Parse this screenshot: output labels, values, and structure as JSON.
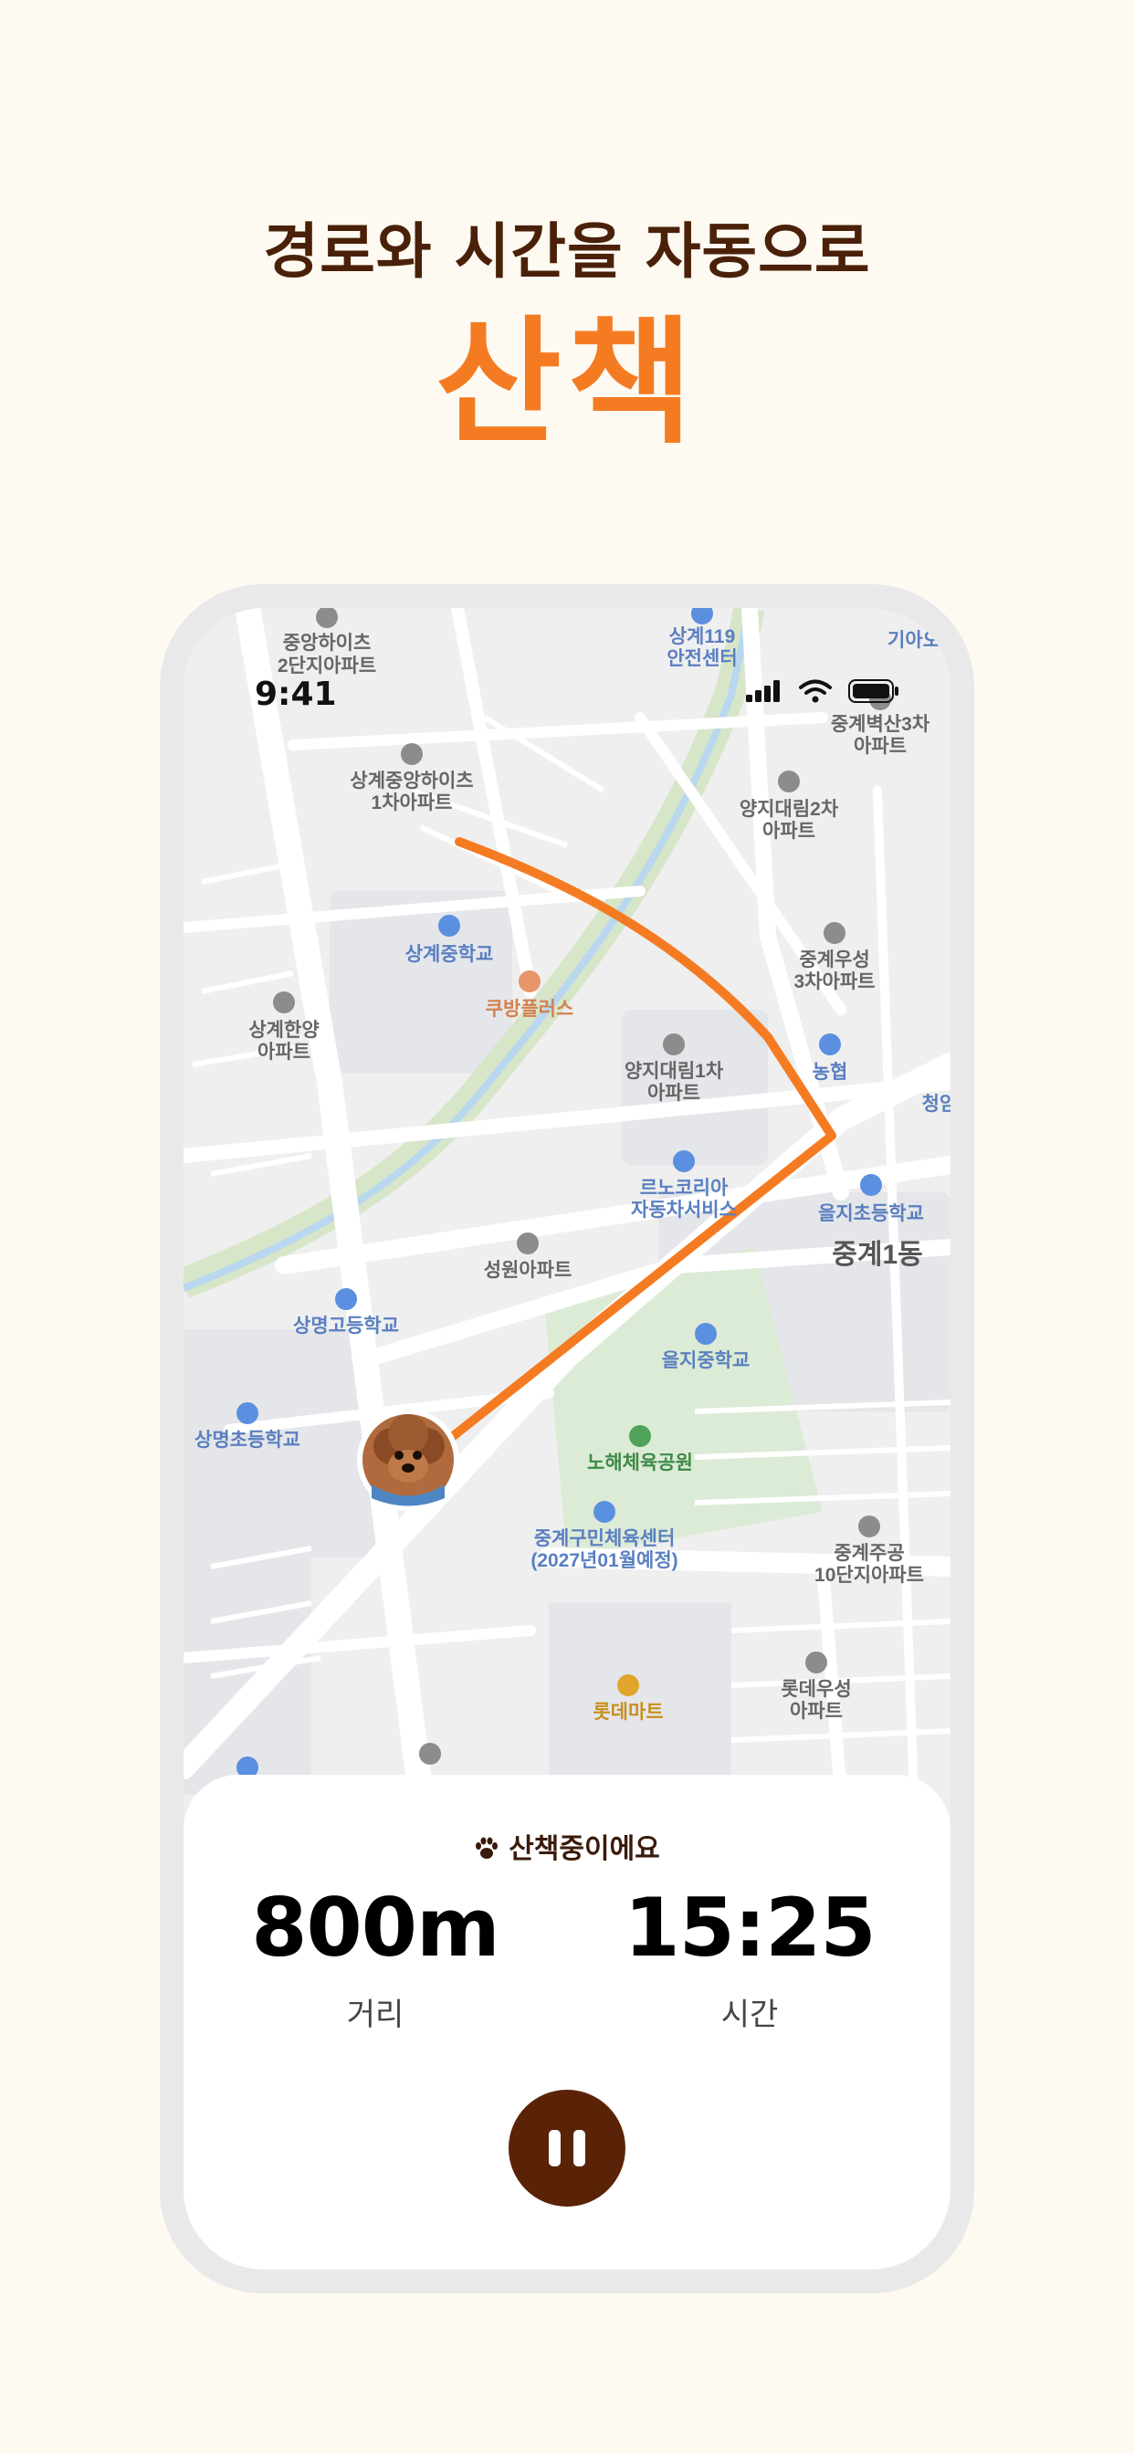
{
  "headline": "경로와 시간을 자동으로",
  "title": "산책",
  "status_bar": {
    "time": "9:41"
  },
  "map": {
    "labels": [
      "중앙하이츠",
      "2단지아파트",
      "상계119",
      "안전센터",
      "기아오",
      "중계벽산3차",
      "아파트",
      "상계중앙하이츠",
      "1차아파트",
      "양지대림2차",
      "아파트",
      "상계중학교",
      "쿠방플러스",
      "중계우성",
      "3차아파트",
      "상계한양",
      "아파트",
      "양지대림1차",
      "아파트",
      "농협",
      "청암",
      "르노코리아",
      "자동차서비스",
      "을지초등학교",
      "중계1동",
      "성원아파트",
      "상명고등학교",
      "을지중학교",
      "상명초등학교",
      "노해체육공원",
      "중계구민체육센터",
      "(2027년01월예정)",
      "중계주공",
      "10단지아파트",
      "롯데마트",
      "롯데우성",
      "아파트"
    ]
  },
  "sheet": {
    "status_text": "산책중이에요",
    "distance": {
      "value": "800m",
      "label": "거리"
    },
    "time": {
      "value": "15:25",
      "label": "시간"
    }
  },
  "colors": {
    "accent": "#F57B22",
    "brown": "#4A2108",
    "pause_button": "#5A2308",
    "background": "#FEFAF2"
  }
}
